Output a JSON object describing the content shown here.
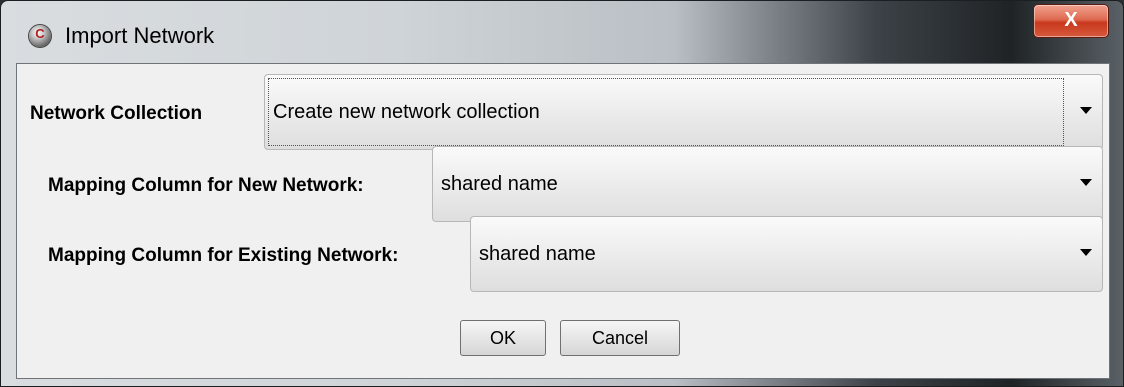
{
  "window": {
    "title": "Import Network",
    "close_label": "X"
  },
  "form": {
    "network_collection": {
      "label": "Network Collection",
      "value": "Create new network collection"
    },
    "mapping_new": {
      "label": "Mapping Column for New Network:",
      "value": "shared name"
    },
    "mapping_existing": {
      "label": "Mapping Column for Existing Network:",
      "value": "shared name"
    }
  },
  "buttons": {
    "ok_label": "OK",
    "cancel_label": "Cancel"
  },
  "icons": {
    "app": "cytoscape-icon",
    "dropdown": "chevron-down-icon"
  },
  "colors": {
    "close_button": "#d14e32",
    "dialog_background": "#f0f0f0"
  }
}
